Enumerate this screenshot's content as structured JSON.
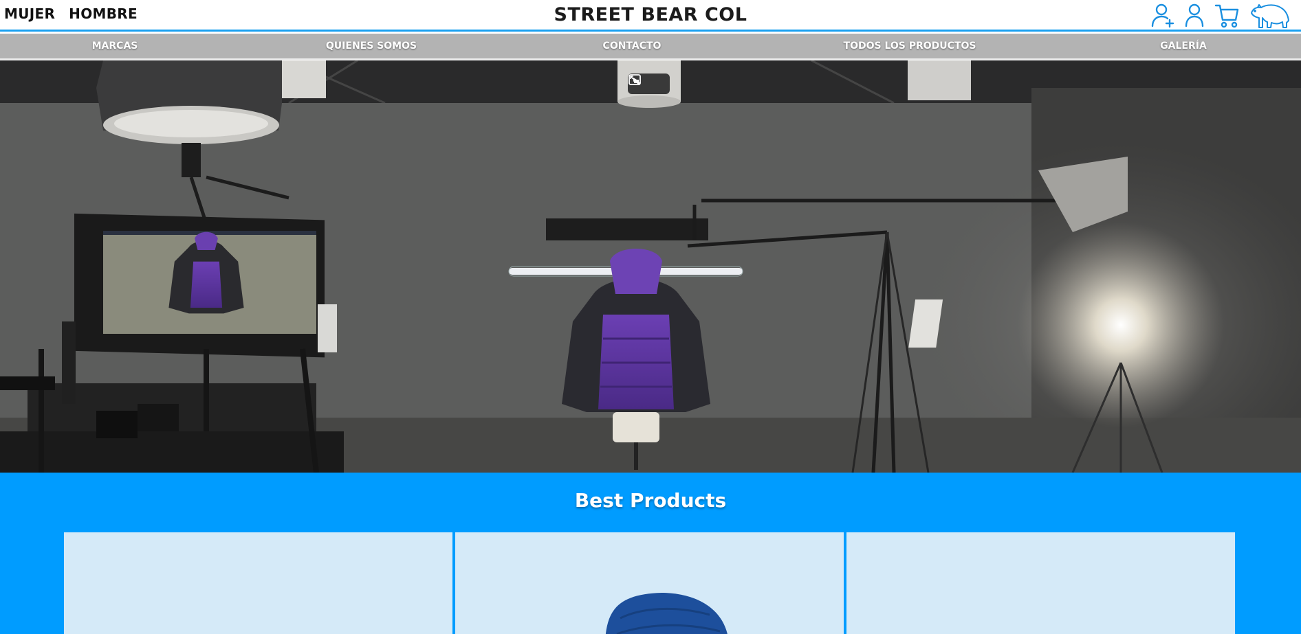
{
  "header": {
    "gender_links": [
      "MUJER",
      "HOMBRE"
    ],
    "brand": "STREET BEAR COL",
    "icons": [
      "add-user-icon",
      "user-icon",
      "cart-icon",
      "polar-bear-logo"
    ],
    "accent_color": "#1aa0f0"
  },
  "nav": {
    "items": [
      "MARCAS",
      "QUIENES SOMOS",
      "CONTACTO",
      "TODOS LOS PRODUCTOS",
      "GALERÍA"
    ],
    "background": "#b3b3b3"
  },
  "hero": {
    "media": "studio video",
    "controls": [
      "picture-in-picture-icon",
      "video-options-icon"
    ]
  },
  "products": {
    "title": "Best Products",
    "background": "#009cff",
    "cards": [
      {
        "image": ""
      },
      {
        "image": "blue-jacket"
      },
      {
        "image": ""
      }
    ]
  }
}
